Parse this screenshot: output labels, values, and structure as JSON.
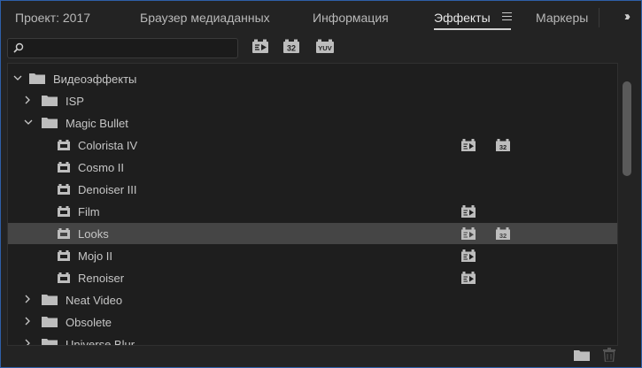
{
  "tabs": [
    {
      "label": "Проект: 2017"
    },
    {
      "label": "Браузер медиаданных"
    },
    {
      "label": "Информация"
    },
    {
      "label": "Эффекты",
      "active": true
    },
    {
      "label": "Маркеры"
    }
  ],
  "search": {
    "value": "",
    "placeholder": ""
  },
  "filter_buttons": [
    {
      "icon": "accelerated-effects-icon"
    },
    {
      "icon": "32-bit-effects-icon",
      "text": "32"
    },
    {
      "icon": "yuv-effects-icon",
      "text": "YUV"
    }
  ],
  "tree": [
    {
      "label": "Видеоэффекты",
      "type": "folder",
      "expanded": true
    },
    {
      "label": "ISP",
      "type": "folder",
      "expanded": false
    },
    {
      "label": "Magic Bullet",
      "type": "folder",
      "expanded": true
    },
    {
      "label": "Colorista IV",
      "type": "effect",
      "badges": [
        "accel",
        "32"
      ]
    },
    {
      "label": "Cosmo II",
      "type": "effect",
      "badges": []
    },
    {
      "label": "Denoiser III",
      "type": "effect",
      "badges": []
    },
    {
      "label": "Film",
      "type": "effect",
      "badges": [
        "accel"
      ]
    },
    {
      "label": "Looks",
      "type": "effect",
      "badges": [
        "accel",
        "32"
      ],
      "selected": true
    },
    {
      "label": "Mojo II",
      "type": "effect",
      "badges": [
        "accel"
      ]
    },
    {
      "label": "Renoiser",
      "type": "effect",
      "badges": [
        "accel"
      ]
    },
    {
      "label": "Neat Video",
      "type": "folder",
      "expanded": false
    },
    {
      "label": "Obsolete",
      "type": "folder",
      "expanded": false
    },
    {
      "label": "Universe Blur",
      "type": "folder",
      "expanded": false
    }
  ],
  "badge_32": "32",
  "colors": {
    "panel": "#232323",
    "list": "#1e1e1e",
    "selection": "#454545",
    "focus_border": "#2e5fa8"
  }
}
